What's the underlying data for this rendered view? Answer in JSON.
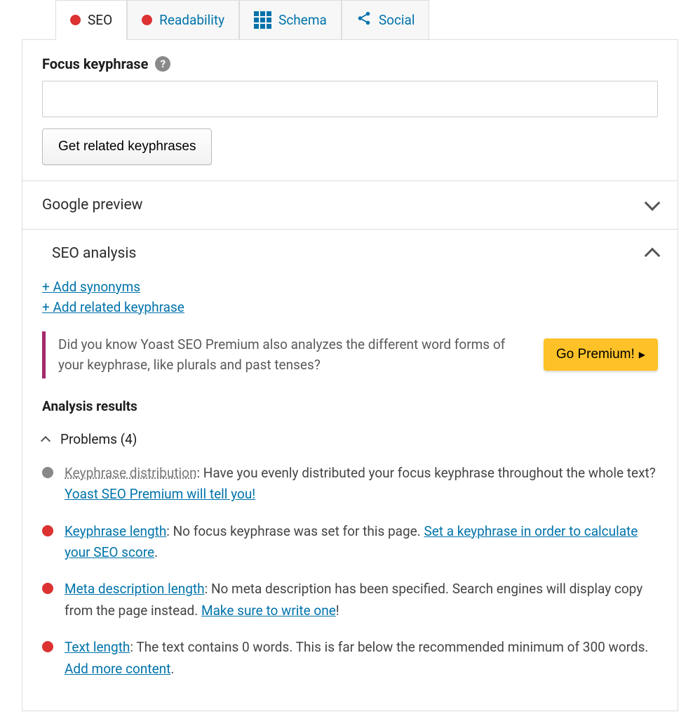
{
  "tabs": {
    "seo": "SEO",
    "readability": "Readability",
    "schema": "Schema",
    "social": "Social"
  },
  "focus": {
    "label": "Focus keyphrase",
    "value": "",
    "button": "Get related keyphrases"
  },
  "sections": {
    "google_preview": "Google preview",
    "seo_analysis": "SEO analysis"
  },
  "analysis": {
    "add_synonyms": "+ Add synonyms",
    "add_related": "+ Add related keyphrase",
    "promo_text": "Did you know Yoast SEO Premium also analyzes the different word forms of your keyphrase, like plurals and past tenses?",
    "promo_btn": "Go Premium!",
    "results_heading": "Analysis results",
    "problems_label": "Problems (4)",
    "items": [
      {
        "bullet": "gray",
        "label": "Keyphrase distribution",
        "label_style": "gray",
        "text": ": Have you evenly distributed your focus keyphrase throughout the whole text? ",
        "link": "Yoast SEO Premium will tell you!",
        "tail": ""
      },
      {
        "bullet": "red",
        "label": "Keyphrase length",
        "label_style": "link",
        "text": ": No focus keyphrase was set for this page. ",
        "link": "Set a keyphrase in order to calculate your SEO score",
        "tail": "."
      },
      {
        "bullet": "red",
        "label": "Meta description length",
        "label_style": "link",
        "text": ": No meta description has been specified. Search engines will display copy from the page instead. ",
        "link": "Make sure to write one",
        "tail": "!"
      },
      {
        "bullet": "red",
        "label": "Text length",
        "label_style": "link",
        "text": ": The text contains 0 words. This is far below the recommended minimum of 300 words. ",
        "link": "Add more content",
        "tail": "."
      }
    ]
  }
}
